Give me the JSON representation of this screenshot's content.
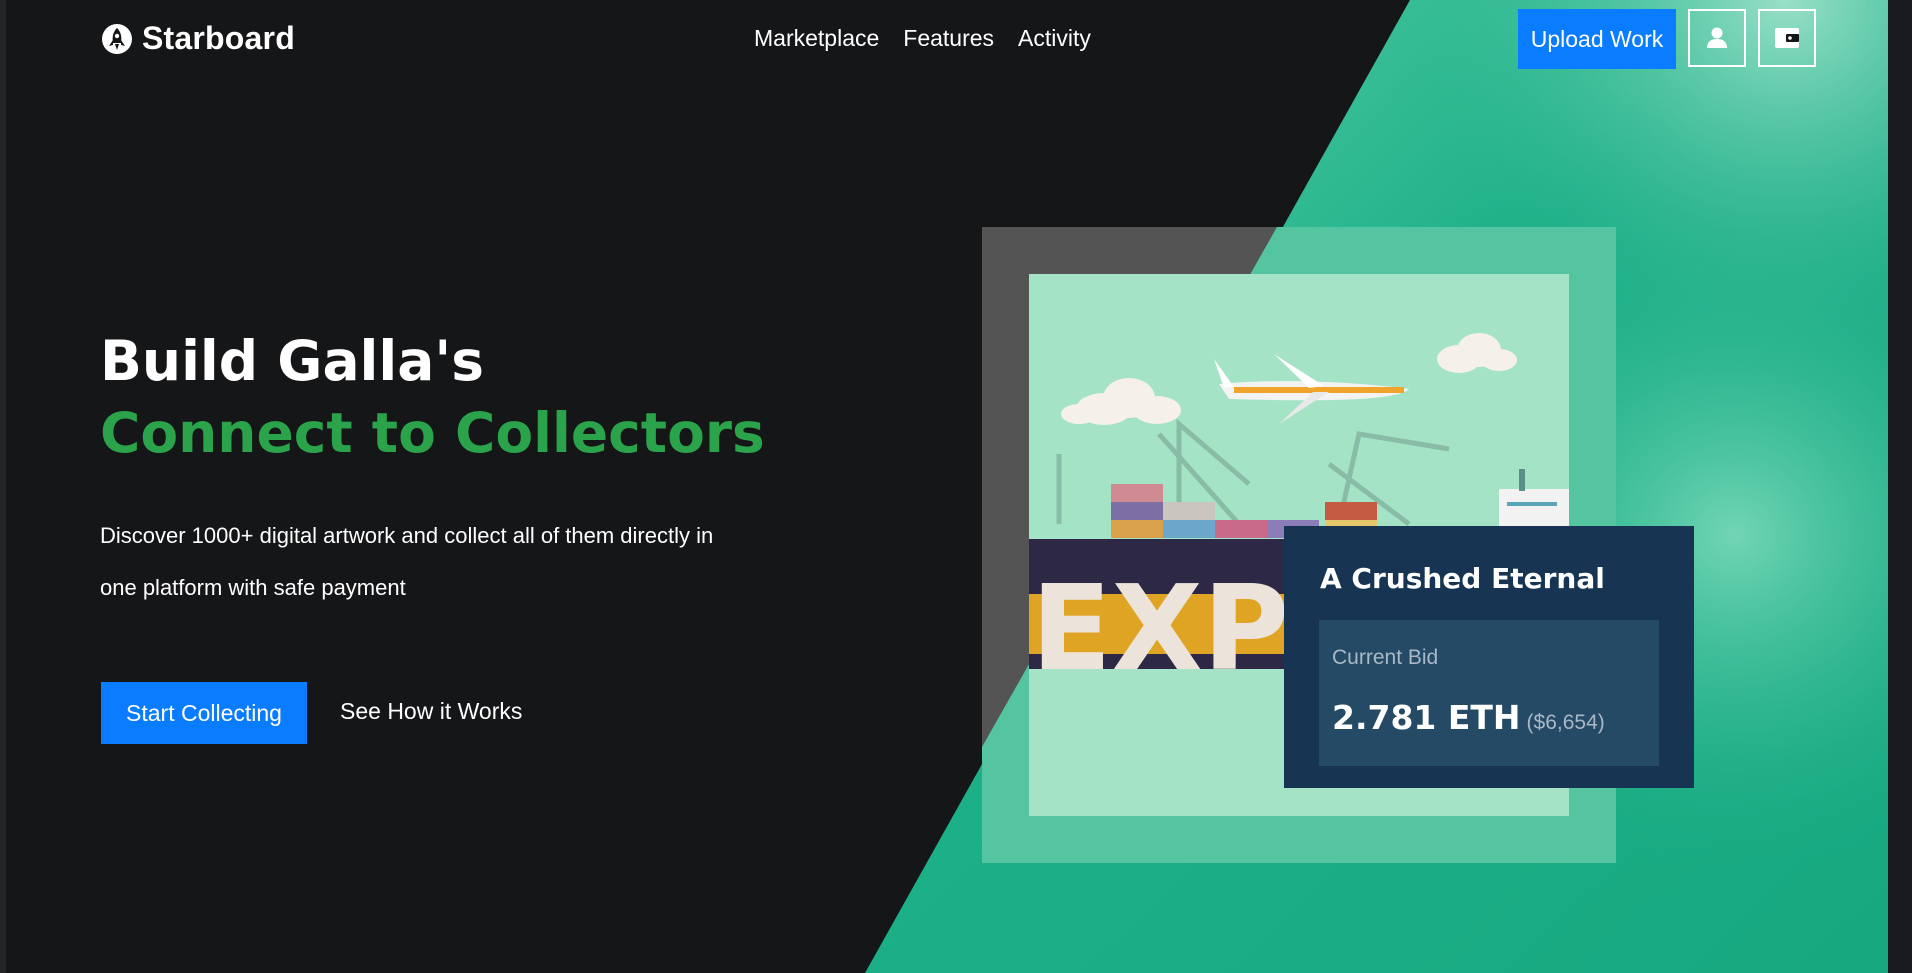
{
  "brand": {
    "name": "Starboard",
    "logo_icon": "rocket-logo-icon"
  },
  "nav": {
    "links": [
      {
        "label": "Marketplace"
      },
      {
        "label": "Features"
      },
      {
        "label": "Activity"
      }
    ],
    "upload_label": "Upload Work",
    "user_icon": "user-icon",
    "wallet_icon": "wallet-icon"
  },
  "hero": {
    "title_line1": "Build Galla's",
    "title_line2": "Connect to Collectors",
    "description": "Discover 1000+ digital artwork and collect all of them directly in one platform with safe payment",
    "primary_cta": "Start Collecting",
    "secondary_cta": "See How it Works"
  },
  "artwork": {
    "banner_text": "EXP",
    "title": "A Crushed Eternal",
    "bid_label": "Current Bid",
    "bid_amount": "2.781 ETH",
    "bid_usd": "($6,654)"
  },
  "colors": {
    "background": "#151618",
    "accent_green": "#2aa34a",
    "teal": "#1db088",
    "primary_blue": "#0a7cff",
    "card_navy": "#173553"
  }
}
